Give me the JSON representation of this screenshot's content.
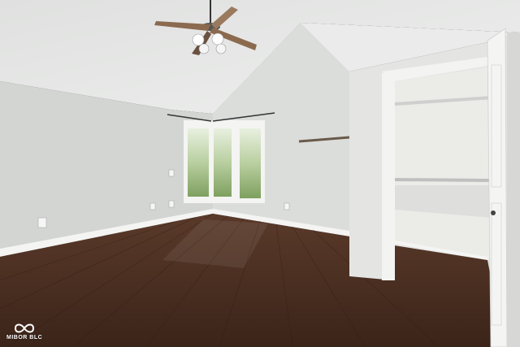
{
  "watermark": {
    "text": "MIBOR BLC",
    "icon": "infinity-icon"
  },
  "colors": {
    "ceiling": "#e6e7e6",
    "wall_left": "#d5d7d5",
    "wall_back": "#dcdedc",
    "floor": "#4a2f22",
    "trim": "#f2f2f0",
    "closet_interior": "#ebebe8"
  }
}
